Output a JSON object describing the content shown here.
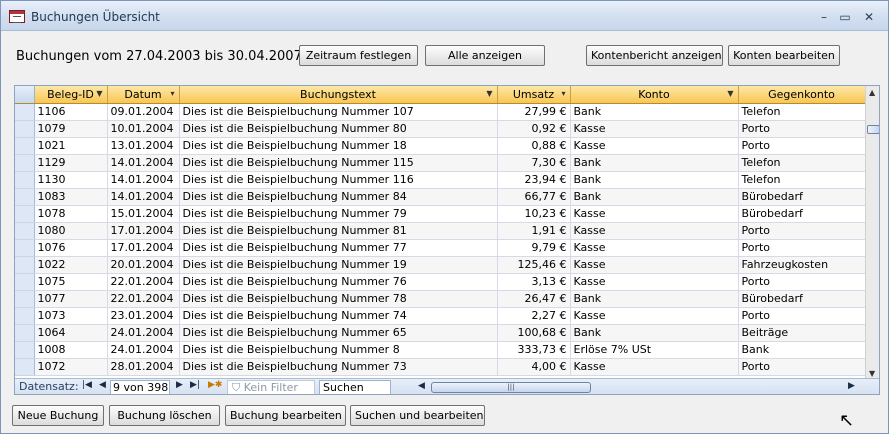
{
  "window": {
    "title": "Buchungen Übersicht",
    "minimize": "–",
    "maximize": "▭",
    "close": "✕"
  },
  "header": {
    "range_label": "Buchungen vom 27.04.2003 bis 30.04.2007",
    "btn_period": "Zeitraum festlegen",
    "btn_all": "Alle anzeigen",
    "btn_account_report": "Kontenbericht anzeigen",
    "btn_edit_accounts": "Konten bearbeiten"
  },
  "grid": {
    "columns": [
      "Beleg-ID",
      "Datum",
      "Buchungstext",
      "Umsatz",
      "Konto",
      "Gegenkonto"
    ],
    "rows": [
      [
        "1106",
        "09.01.2004",
        "Dies ist die Beispielbuchung Nummer 107",
        "27,99 €",
        "Bank",
        "Telefon"
      ],
      [
        "1079",
        "10.01.2004",
        "Dies ist die Beispielbuchung Nummer 80",
        "0,92 €",
        "Kasse",
        "Porto"
      ],
      [
        "1021",
        "13.01.2004",
        "Dies ist die Beispielbuchung Nummer 18",
        "0,88 €",
        "Kasse",
        "Porto"
      ],
      [
        "1129",
        "14.01.2004",
        "Dies ist die Beispielbuchung Nummer 115",
        "7,30 €",
        "Bank",
        "Telefon"
      ],
      [
        "1130",
        "14.01.2004",
        "Dies ist die Beispielbuchung Nummer 116",
        "23,94 €",
        "Bank",
        "Telefon"
      ],
      [
        "1083",
        "14.01.2004",
        "Dies ist die Beispielbuchung Nummer 84",
        "66,77 €",
        "Bank",
        "Bürobedarf"
      ],
      [
        "1078",
        "15.01.2004",
        "Dies ist die Beispielbuchung Nummer 79",
        "10,23 €",
        "Kasse",
        "Bürobedarf"
      ],
      [
        "1080",
        "17.01.2004",
        "Dies ist die Beispielbuchung Nummer 81",
        "1,91 €",
        "Kasse",
        "Porto"
      ],
      [
        "1076",
        "17.01.2004",
        "Dies ist die Beispielbuchung Nummer 77",
        "9,79 €",
        "Kasse",
        "Porto"
      ],
      [
        "1022",
        "20.01.2004",
        "Dies ist die Beispielbuchung Nummer 19",
        "125,46 €",
        "Kasse",
        "Fahrzeugkosten"
      ],
      [
        "1075",
        "22.01.2004",
        "Dies ist die Beispielbuchung Nummer 76",
        "3,13 €",
        "Kasse",
        "Porto"
      ],
      [
        "1077",
        "22.01.2004",
        "Dies ist die Beispielbuchung Nummer 78",
        "26,47 €",
        "Bank",
        "Bürobedarf"
      ],
      [
        "1073",
        "23.01.2004",
        "Dies ist die Beispielbuchung Nummer 74",
        "2,27 €",
        "Kasse",
        "Porto"
      ],
      [
        "1064",
        "24.01.2004",
        "Dies ist die Beispielbuchung Nummer 65",
        "100,68 €",
        "Bank",
        "Beiträge"
      ],
      [
        "1008",
        "24.01.2004",
        "Dies ist die Beispielbuchung Nummer 8",
        "333,73 €",
        "Erlöse 7% USt",
        "Bank"
      ],
      [
        "1072",
        "28.01.2004",
        "Dies ist die Beispielbuchung Nummer 73",
        "4,00 €",
        "Kasse",
        "Porto"
      ]
    ]
  },
  "navigation": {
    "label": "Datensatz:",
    "position": "9 von 398",
    "no_filter": "Kein Filter",
    "search_placeholder": "Suchen"
  },
  "footer": {
    "btn_new": "Neue Buchung",
    "btn_delete": "Buchung löschen",
    "btn_edit": "Buchung bearbeiten",
    "btn_search_edit": "Suchen und bearbeiten"
  }
}
